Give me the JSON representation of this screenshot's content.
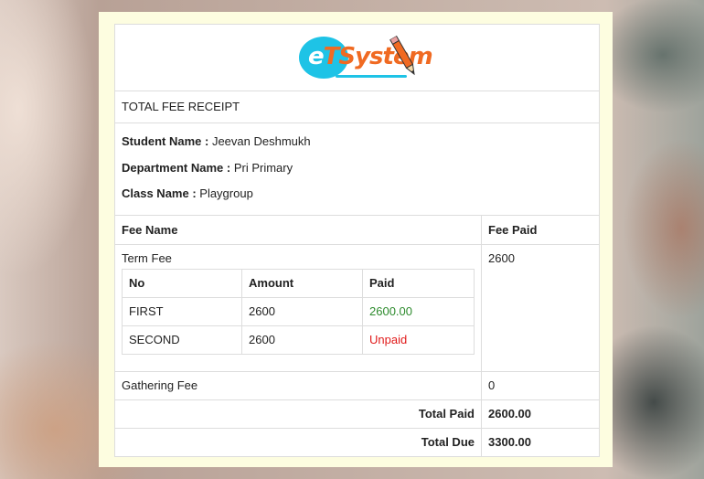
{
  "logo": {
    "name": "eTSystem",
    "first_letter": "e",
    "rest": "TSystem",
    "icon": "pencil-icon"
  },
  "receipt": {
    "title": "TOTAL FEE RECEIPT",
    "student": {
      "label": "Student Name :",
      "value": " Jeevan Deshmukh"
    },
    "department": {
      "label": "Department Name :",
      "value": " Pri Primary"
    },
    "class": {
      "label": "Class Name :",
      "value": " Playgroup"
    },
    "headers": {
      "fee_name": "Fee Name",
      "fee_paid": "Fee Paid"
    },
    "fees": [
      {
        "name": "Term Fee",
        "paid": "2600",
        "installments_headers": {
          "no": "No",
          "amount": "Amount",
          "paid": "Paid"
        },
        "installments": [
          {
            "no": "FIRST",
            "amount": "2600",
            "paid": "2600.00",
            "status_color": "#2e8b2e"
          },
          {
            "no": "SECOND",
            "amount": "2600",
            "paid": "Unpaid",
            "status_color": "#e11b1b"
          }
        ]
      },
      {
        "name": "Gathering Fee",
        "paid": "0"
      }
    ],
    "total_paid": {
      "label": "Total Paid",
      "value": "2600.00"
    },
    "total_due": {
      "label": "Total Due",
      "value": "3300.00"
    }
  },
  "colors": {
    "frame_bg": "#fdfde0",
    "accent_blue": "#1ec3e6",
    "accent_orange": "#f06a22"
  }
}
